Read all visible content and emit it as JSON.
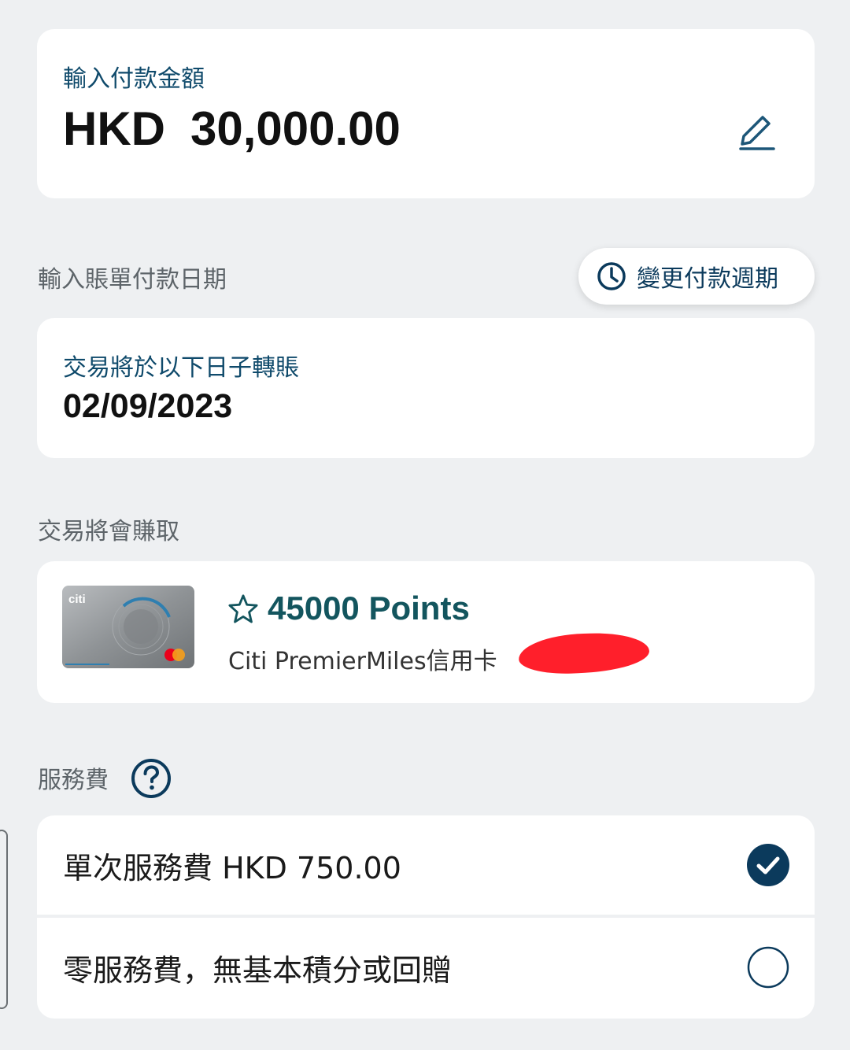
{
  "amount": {
    "label": "輸入付款金額",
    "currency": "HKD",
    "value": "30,000.00"
  },
  "schedule": {
    "section_label": "輸入賬單付款日期",
    "change_cycle_label": "變更付款週期",
    "date_label": "交易將於以下日子轉賬",
    "date_value": "02/09/2023"
  },
  "rewards": {
    "section_label": "交易將會賺取",
    "points": "45000 Points",
    "card_name": "Citi PremierMiles信用卡",
    "card_brand": "citi"
  },
  "service_fee": {
    "section_label": "服務費",
    "options": [
      {
        "label": "單次服務費 HKD 750.00",
        "selected": true
      },
      {
        "label": "零服務費，無基本積分或回贈",
        "selected": false
      }
    ]
  },
  "colors": {
    "background": "#eef0f2",
    "primary_navy": "#0b3a5c",
    "points_teal": "#13555e",
    "redaction": "#ff1f2b"
  },
  "icons": {
    "edit": "pencil-icon",
    "cycle": "clock-icon",
    "points": "star-icon",
    "help": "question-circle-icon",
    "selected": "check-circle-icon",
    "unselected": "empty-circle-icon"
  }
}
